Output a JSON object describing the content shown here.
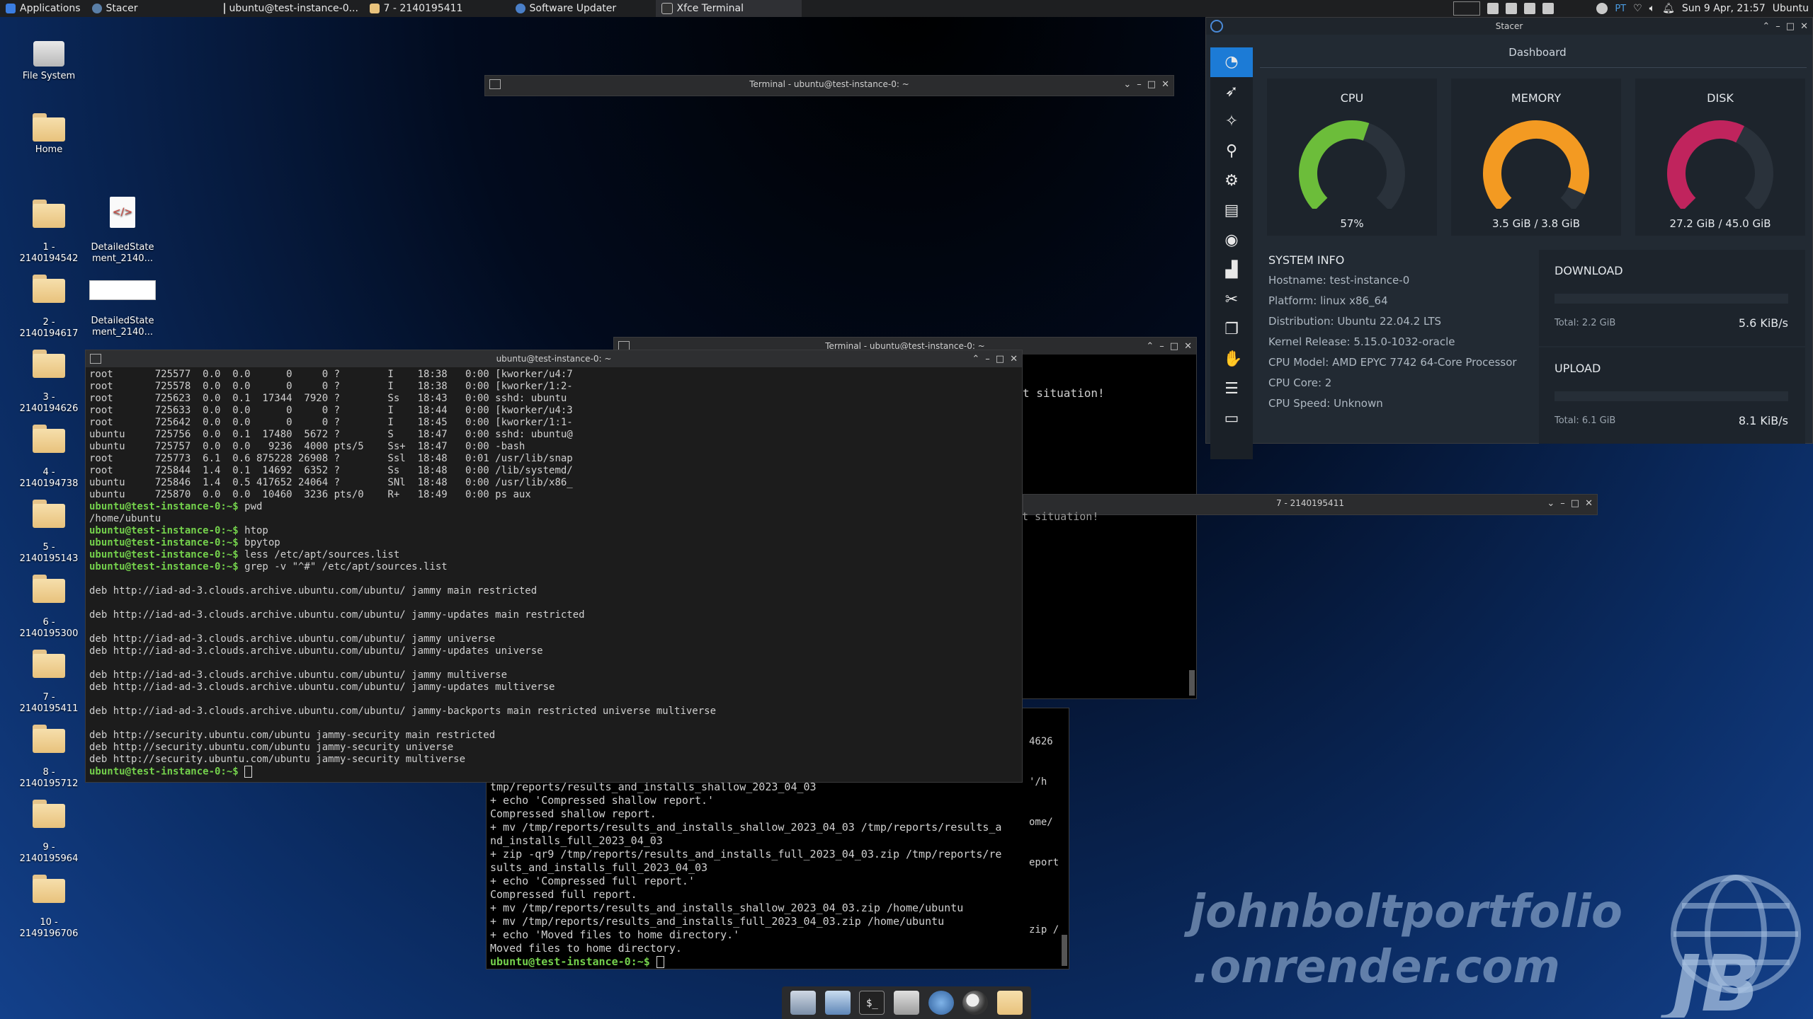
{
  "panel": {
    "applications": "Applications",
    "tasks": [
      {
        "label": "Stacer",
        "icon": "stacer-icon"
      },
      {
        "label": "ubuntu@test-instance-0...",
        "icon": "terminal-icon"
      },
      {
        "label": "7 - 2140195411",
        "icon": "folder-icon"
      },
      {
        "label": "Software Updater",
        "icon": "updater-icon"
      },
      {
        "label": "Xfce Terminal",
        "icon": "terminal-icon"
      }
    ],
    "keyboard_layout": "PT",
    "clock": "Sun  9 Apr, 21:57",
    "user": "Ubuntu"
  },
  "desktop": {
    "icons": [
      {
        "label": "File System",
        "kind": "drive"
      },
      {
        "label": "Home",
        "kind": "home"
      },
      {
        "label": "1 -\n2140194542",
        "kind": "folder"
      },
      {
        "label": "DetailedState\nment_2140...",
        "kind": "html"
      },
      {
        "label": "2 -\n2140194617",
        "kind": "folder"
      },
      {
        "label": "DetailedState\nment_2140...",
        "kind": "image"
      },
      {
        "label": "3 -\n2140194626",
        "kind": "folder"
      },
      {
        "label": "4 -\n2140194738",
        "kind": "folder"
      },
      {
        "label": "5 -\n2140195143",
        "kind": "folder"
      },
      {
        "label": "6 -\n2140195300",
        "kind": "folder"
      },
      {
        "label": "7 -\n2140195411",
        "kind": "folder"
      },
      {
        "label": "8 -\n2140195712",
        "kind": "folder"
      },
      {
        "label": "9 -\n2140195964",
        "kind": "folder"
      },
      {
        "label": "10 -\n2149196706",
        "kind": "folder"
      }
    ]
  },
  "windows": {
    "terminal_top": {
      "title": "Terminal - ubuntu@test-instance-0: ~"
    },
    "terminal_mid": {
      "title": "Terminal - ubuntu@test-instance-0: ~",
      "lines": [
        "t situation!"
      ]
    },
    "folder7": {
      "title": "7 - 2140195411",
      "lines": [
        "t situation!"
      ]
    },
    "terminal_main": {
      "title": "ubuntu@test-instance-0: ~",
      "lines": [
        {
          "t": "root       725577  0.0  0.0      0     0 ?        I    18:38   0:00 [kworker/u4:7"
        },
        {
          "t": "root       725578  0.0  0.0      0     0 ?        I    18:38   0:00 [kworker/1:2-"
        },
        {
          "t": "root       725623  0.0  0.1  17344  7920 ?        Ss   18:43   0:00 sshd: ubuntu"
        },
        {
          "t": "root       725633  0.0  0.0      0     0 ?        I    18:44   0:00 [kworker/u4:3"
        },
        {
          "t": "root       725642  0.0  0.0      0     0 ?        I    18:45   0:00 [kworker/1:1-"
        },
        {
          "t": "ubuntu     725756  0.0  0.1  17480  5672 ?        S    18:47   0:00 sshd: ubuntu@"
        },
        {
          "t": "ubuntu     725757  0.0  0.0   9236  4000 pts/5    Ss+  18:47   0:00 -bash"
        },
        {
          "t": "root       725773  6.1  0.6 875228 26908 ?        Ssl  18:48   0:01 /usr/lib/snap"
        },
        {
          "t": "root       725844  1.4  0.1  14692  6352 ?        Ss   18:48   0:00 /lib/systemd/"
        },
        {
          "t": "ubuntu     725846  1.4  0.5 417652 24064 ?        SNl  18:48   0:00 /usr/lib/x86_"
        },
        {
          "t": "ubuntu     725870  0.0  0.0  10460  3236 pts/0    R+   18:49   0:00 ps aux"
        },
        {
          "p": "ubuntu@test-instance-0:~$",
          "t": " pwd"
        },
        {
          "t": "/home/ubuntu"
        },
        {
          "p": "ubuntu@test-instance-0:~$",
          "t": " htop"
        },
        {
          "p": "ubuntu@test-instance-0:~$",
          "t": " bpytop"
        },
        {
          "p": "ubuntu@test-instance-0:~$",
          "t": " less /etc/apt/sources.list"
        },
        {
          "p": "ubuntu@test-instance-0:~$",
          "t": " grep -v \"^#\" /etc/apt/sources.list"
        },
        {
          "t": ""
        },
        {
          "t": "deb http://iad-ad-3.clouds.archive.ubuntu.com/ubuntu/ jammy main restricted"
        },
        {
          "t": ""
        },
        {
          "t": "deb http://iad-ad-3.clouds.archive.ubuntu.com/ubuntu/ jammy-updates main restricted"
        },
        {
          "t": ""
        },
        {
          "t": "deb http://iad-ad-3.clouds.archive.ubuntu.com/ubuntu/ jammy universe"
        },
        {
          "t": "deb http://iad-ad-3.clouds.archive.ubuntu.com/ubuntu/ jammy-updates universe"
        },
        {
          "t": ""
        },
        {
          "t": "deb http://iad-ad-3.clouds.archive.ubuntu.com/ubuntu/ jammy multiverse"
        },
        {
          "t": "deb http://iad-ad-3.clouds.archive.ubuntu.com/ubuntu/ jammy-updates multiverse"
        },
        {
          "t": ""
        },
        {
          "t": "deb http://iad-ad-3.clouds.archive.ubuntu.com/ubuntu/ jammy-backports main restricted universe multiverse"
        },
        {
          "t": ""
        },
        {
          "t": "deb http://security.ubuntu.com/ubuntu jammy-security main restricted"
        },
        {
          "t": "deb http://security.ubuntu.com/ubuntu jammy-security universe"
        },
        {
          "t": "deb http://security.ubuntu.com/ubuntu jammy-security multiverse"
        },
        {
          "p": "ubuntu@test-instance-0:~$",
          "t": " ",
          "cursor": true
        }
      ]
    },
    "terminal_bottom": {
      "side_fragments": [
        "4626",
        "'/h",
        "ome/",
        "eport",
        "",
        "zip /"
      ],
      "lines": [
        {
          "t": "tmp/reports/results_and_installs_shallow_2023_04_03"
        },
        {
          "t": "+ echo 'Compressed shallow report.'"
        },
        {
          "t": "Compressed shallow report."
        },
        {
          "t": "+ mv /tmp/reports/results_and_installs_shallow_2023_04_03 /tmp/reports/results_a"
        },
        {
          "t": "nd_installs_full_2023_04_03"
        },
        {
          "t": "+ zip -qr9 /tmp/reports/results_and_installs_full_2023_04_03.zip /tmp/reports/re"
        },
        {
          "t": "sults_and_installs_full_2023_04_03"
        },
        {
          "t": "+ echo 'Compressed full report.'"
        },
        {
          "t": "Compressed full report."
        },
        {
          "t": "+ mv /tmp/reports/results_and_installs_shallow_2023_04_03.zip /home/ubuntu"
        },
        {
          "t": "+ mv /tmp/reports/results_and_installs_full_2023_04_03.zip /home/ubuntu"
        },
        {
          "t": "+ echo 'Moved files to home directory.'"
        },
        {
          "t": "Moved files to home directory."
        },
        {
          "p": "ubuntu@test-instance-0:~$",
          "t": " ",
          "cursor": true
        }
      ]
    }
  },
  "stacer": {
    "title": "Stacer",
    "page_title": "Dashboard",
    "sidebar": [
      "dashboard-icon",
      "startup-apps-icon",
      "system-cleaner-icon",
      "search-icon",
      "services-icon",
      "uninstaller-icon",
      "resources-icon",
      "gnome-settings-icon",
      "helpers-icon",
      "apt-repository-icon",
      "gnome-icon",
      "settings-icon",
      "feedback-icon"
    ],
    "gauges": [
      {
        "title": "CPU",
        "value": "57%",
        "fraction": 0.57,
        "color": "#6cbd3a"
      },
      {
        "title": "MEMORY",
        "value": "3.5 GiB / 3.8 GiB",
        "fraction": 0.92,
        "color": "#f39a22"
      },
      {
        "title": "DISK",
        "value": "27.2 GiB / 45.0 GiB",
        "fraction": 0.6,
        "color": "#c0245d"
      }
    ],
    "system_info": {
      "heading": "SYSTEM INFO",
      "rows": [
        "Hostname: test-instance-0",
        "Platform: linux x86_64",
        "Distribution: Ubuntu 22.04.2 LTS",
        "Kernel Release: 5.15.0-1032-oracle",
        "CPU Model:  AMD EPYC 7742 64-Core Processor",
        "CPU Core: 2",
        "CPU Speed: Unknown"
      ]
    },
    "download": {
      "title": "DOWNLOAD",
      "total": "Total: 2.2 GiB",
      "speed": "5.6 KiB/s"
    },
    "upload": {
      "title": "UPLOAD",
      "total": "Total: 6.1 GiB",
      "speed": "8.1 KiB/s"
    }
  },
  "watermark": {
    "line1": "johnboltportfolio",
    "line2": ".onrender.com",
    "logo_text": "JB"
  }
}
